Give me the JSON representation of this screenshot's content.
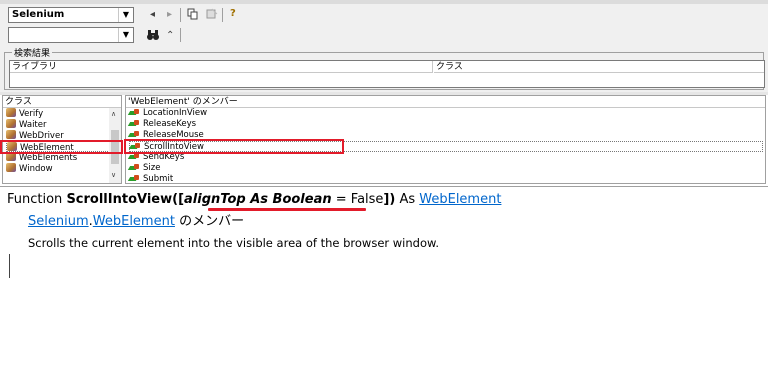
{
  "toolbar": {
    "library_combo": "Selenium",
    "search_combo": "",
    "nav_back": "◂",
    "nav_forward": "▸",
    "help": "?",
    "search_icon": "binoculars-icon",
    "collapse": "⌃"
  },
  "search_results": {
    "group_label": "検索結果",
    "col_library": "ライブラリ",
    "col_class": "クラス"
  },
  "classes": {
    "header": "クラス",
    "items": [
      "Verify",
      "Waiter",
      "WebDriver",
      "WebElement",
      "WebElements",
      "Window"
    ],
    "selected": "WebElement"
  },
  "members": {
    "header": "'WebElement' のメンバー",
    "items": [
      "LocationInView",
      "ReleaseKeys",
      "ReleaseMouse",
      "ScrollIntoView",
      "SendKeys",
      "Size",
      "Submit"
    ],
    "selected": "ScrollIntoView"
  },
  "details": {
    "keyword_function": "Function",
    "func_name": "ScrollIntoView(",
    "open_bracket": "[",
    "param": "alignTop As Boolean",
    "default_part": " = False",
    "close_bracket": "]",
    "close_paren": ")",
    "as_word": " As ",
    "return_type": "WebElement",
    "member_of_lib": "Selenium",
    "member_of_dot": ".",
    "member_of_class": "WebElement",
    "member_of_suffix": " のメンバー",
    "description": "Scrolls the current element into the visible area of the browser window."
  },
  "colors": {
    "highlight_red": "#e21b2a",
    "link_blue": "#0066cc"
  }
}
